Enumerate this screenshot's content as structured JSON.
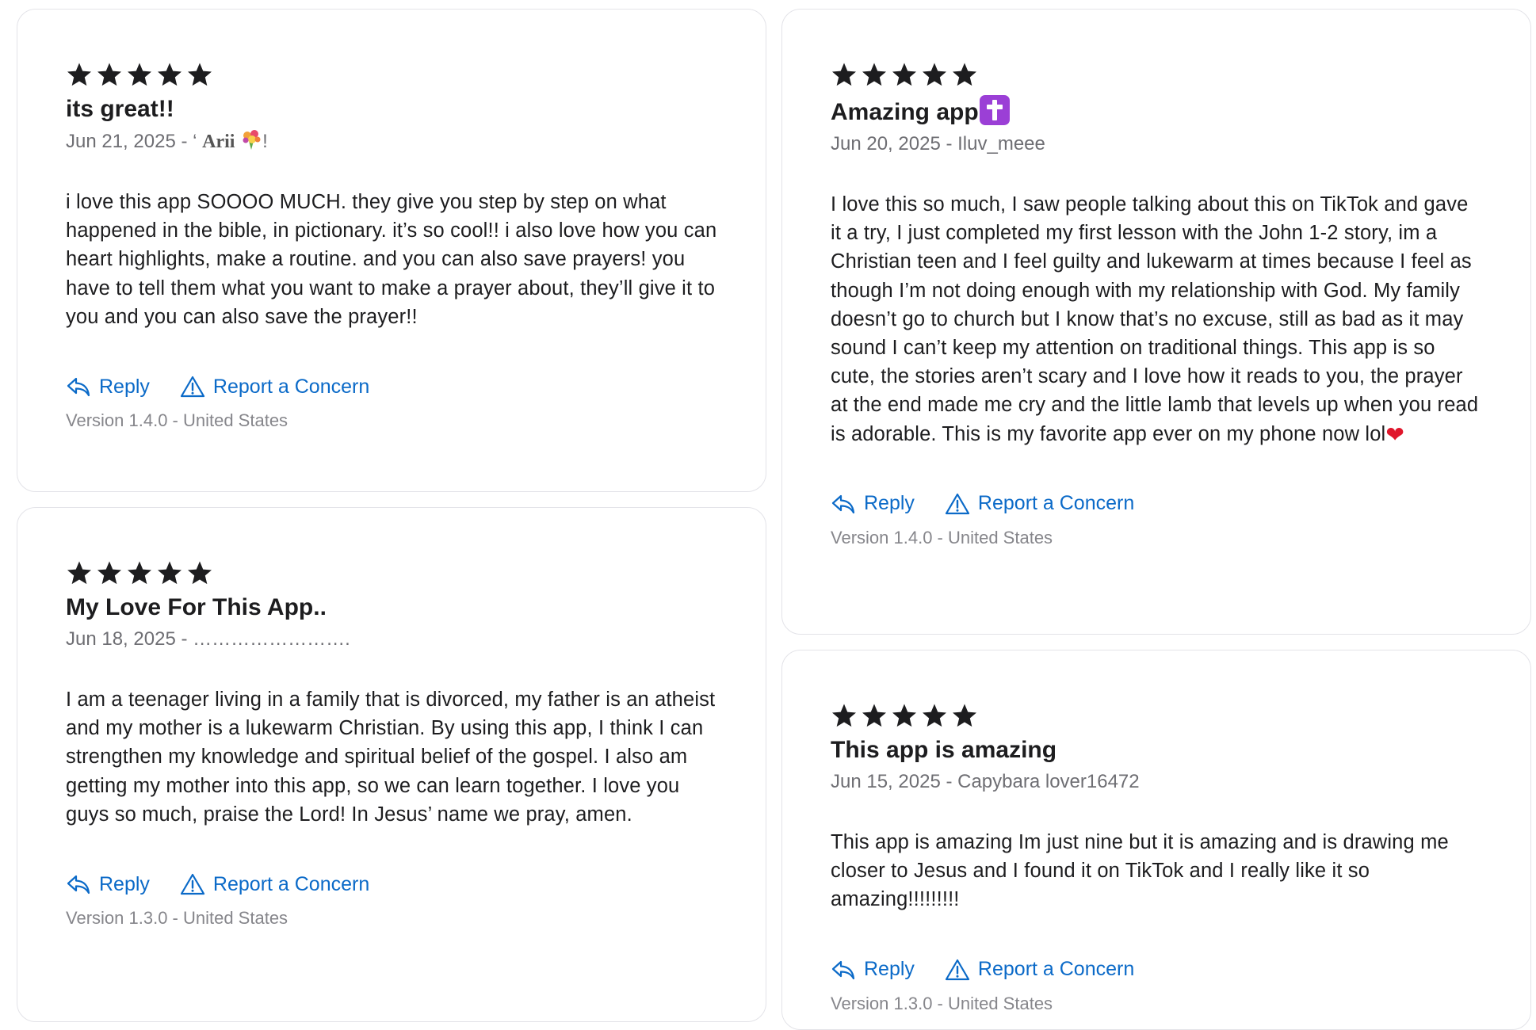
{
  "actions": {
    "reply_label": "Reply",
    "report_label": "Report a Concern"
  },
  "colors": {
    "accent": "#0b6ac8",
    "star": "#1d1d1f",
    "card_border": "#e3e3e8",
    "meta_text": "#6e6e73"
  },
  "reviews": [
    {
      "rating": 5,
      "title": "its great!!",
      "date": "Jun 21, 2025",
      "author_prefix": "‘ ",
      "author_name": "Arii",
      "author_suffix": "!",
      "author_emoji": "bouquet-emoji",
      "body": "i love this app SOOOO MUCH. they give you step by step on what happened in the bible, in pictionary. it’s so cool!! i also love how you can heart highlights, make a routine. and you can also save prayers! you have to tell them what you want to make a prayer about, they’ll give it to you and you can also save the prayer!!",
      "version": "Version 1.4.0 - United States"
    },
    {
      "rating": 5,
      "title": "My Love For This App..",
      "date": "Jun 18, 2025",
      "author": "…………………….",
      "body": "I am a teenager living in a family that is divorced, my father is an atheist and my mother is a lukewarm Christian. By using this app, I think I can strengthen my knowledge and spiritual belief of the gospel. I also am getting my mother into this app, so we can learn together. I love you guys so much, praise the Lord! In Jesus’ name we pray, amen.",
      "version": "Version 1.3.0 - United States"
    },
    {
      "rating": 5,
      "title": "Amazing app",
      "title_emoji": "latin-cross-emoji",
      "date": "Jun 20, 2025",
      "author": "Iluv_meee",
      "body": "I love this so much, I saw people talking about this on TikTok and gave it a try, I just completed my first lesson with the John 1-2 story, im a Christian teen and I feel guilty and lukewarm at times because I feel as though I’m not doing enough with my relationship with God. My family doesn’t go to church but I know that’s no excuse, still as bad as it may sound I can’t keep my attention on traditional things. This app is so cute, the stories aren’t scary and I love how it reads to you, the prayer at the end made me cry and the little lamb that levels up when you read is adorable. This is my favorite app ever on my phone now lol",
      "body_emoji": "❤",
      "version": "Version 1.4.0 - United States"
    },
    {
      "rating": 5,
      "title": "This app is amazing",
      "date": "Jun 15, 2025",
      "author": "Capybara lover16472",
      "body": "This app is amazing Im just nine but it is amazing and is drawing me closer to Jesus and I found it on TikTok and I really like it so amazing!!!!!!!!!",
      "version": "Version 1.3.0 - United States"
    }
  ]
}
